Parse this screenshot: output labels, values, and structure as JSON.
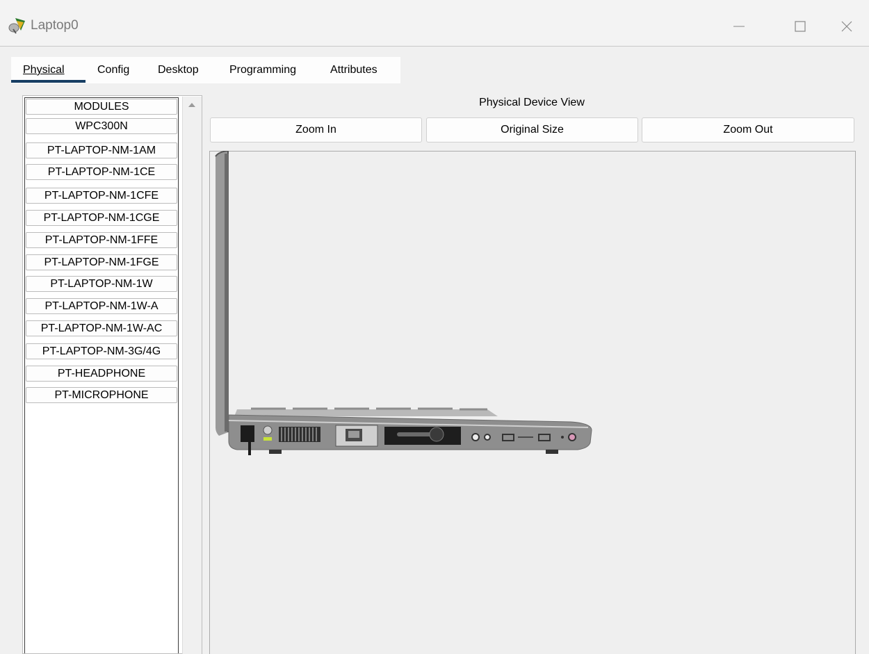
{
  "window": {
    "title": "Laptop0",
    "controls": [
      "minimize",
      "maximize",
      "close"
    ]
  },
  "tabs": [
    {
      "label": "Physical",
      "active": true
    },
    {
      "label": "Config",
      "active": false
    },
    {
      "label": "Desktop",
      "active": false
    },
    {
      "label": "Programming",
      "active": false
    },
    {
      "label": "Attributes",
      "active": false
    }
  ],
  "modules": {
    "items": [
      "MODULES",
      "WPC300N",
      "PT-LAPTOP-NM-1AM",
      "PT-LAPTOP-NM-1CE",
      "PT-LAPTOP-NM-1CFE",
      "PT-LAPTOP-NM-1CGE",
      "PT-LAPTOP-NM-1FFE",
      "PT-LAPTOP-NM-1FGE",
      "PT-LAPTOP-NM-1W",
      "PT-LAPTOP-NM-1W-A",
      "PT-LAPTOP-NM-1W-AC",
      "PT-LAPTOP-NM-3G/4G",
      "PT-HEADPHONE",
      "PT-MICROPHONE"
    ]
  },
  "physical_view": {
    "title": "Physical Device View",
    "zoom_in": "Zoom In",
    "original_size": "Original Size",
    "zoom_out": "Zoom Out"
  },
  "colors": {
    "tab_accent": "#173e63",
    "laptop_body": "#8a8a8a",
    "laptop_panel": "#3c3c3c"
  }
}
